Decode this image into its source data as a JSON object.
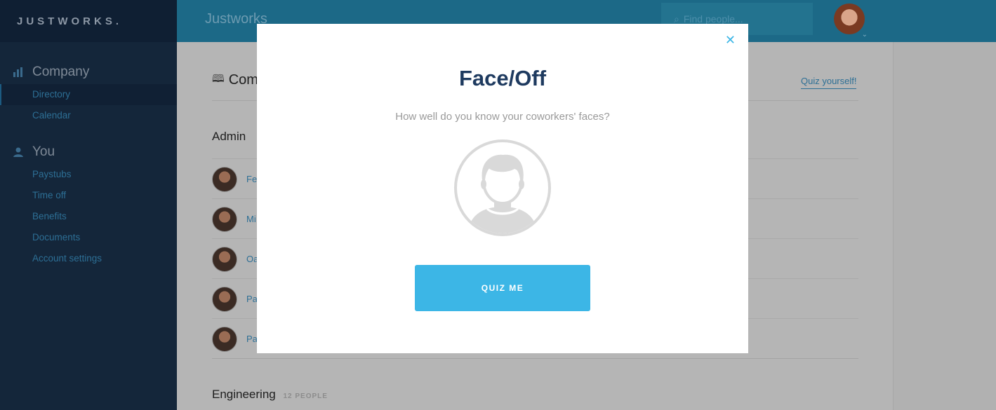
{
  "app": {
    "logo_text": "JUSTWORKS.",
    "header_title": "Justworks"
  },
  "search": {
    "placeholder": "Find people..."
  },
  "sidebar": {
    "sections": [
      {
        "heading": "Company",
        "icon": "bar-chart-icon",
        "items": [
          {
            "label": "Directory",
            "active": true
          },
          {
            "label": "Calendar"
          }
        ]
      },
      {
        "heading": "You",
        "icon": "person-icon",
        "items": [
          {
            "label": "Paystubs"
          },
          {
            "label": "Time off"
          },
          {
            "label": "Benefits"
          },
          {
            "label": "Documents"
          },
          {
            "label": "Account settings"
          }
        ]
      }
    ]
  },
  "page": {
    "heading_visible": "Com",
    "quiz_link": "Quiz yourself!",
    "groups": [
      {
        "name": "Admin",
        "people_visible": [
          "Fe",
          "Mi",
          "Oa",
          "Pa",
          "Pa"
        ]
      },
      {
        "name": "Engineering",
        "count": "12 PEOPLE"
      }
    ]
  },
  "modal": {
    "title": "Face/Off",
    "subtitle": "How well do you know your coworkers' faces?",
    "button_label": "QUIZ ME",
    "close_icon": "close-icon",
    "colors": {
      "accent": "#3cb6e6",
      "title": "#1e3a5f"
    }
  }
}
